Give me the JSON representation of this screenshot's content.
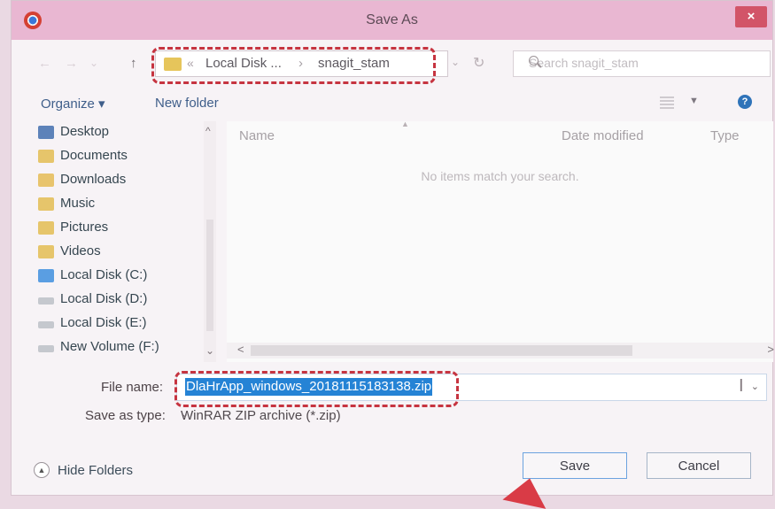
{
  "window": {
    "title": "Save As",
    "close_glyph": "×"
  },
  "toolbar": {
    "back_glyph": "←",
    "forward_glyph": "→",
    "recent_glyph": "⌄",
    "up_glyph": "↑",
    "address": {
      "overflow": "«",
      "part1": "Local Disk ...",
      "separator": "›",
      "part2": "snagit_stam"
    },
    "dropdown_glyph": "⌄",
    "refresh_glyph": "↻",
    "search_placeholder": "Search snagit_stam"
  },
  "commands": {
    "organize": "Organize ▾",
    "new_folder": "New folder",
    "view_chevron": "▼",
    "help": "?"
  },
  "sidebar": {
    "items": [
      {
        "label": "Desktop",
        "icon": "desktop-icon",
        "color": "#5d82b9"
      },
      {
        "label": "Documents",
        "icon": "documents-icon",
        "color": "#e6c56b"
      },
      {
        "label": "Downloads",
        "icon": "downloads-icon",
        "color": "#e8c46d"
      },
      {
        "label": "Music",
        "icon": "music-icon",
        "color": "#e6c56b"
      },
      {
        "label": "Pictures",
        "icon": "pictures-icon",
        "color": "#e6c56b"
      },
      {
        "label": "Videos",
        "icon": "videos-icon",
        "color": "#e6c56b"
      },
      {
        "label": "Local Disk (C:)",
        "icon": "windows-drive-icon",
        "color": "#5a9ee2"
      },
      {
        "label": "Local Disk (D:)",
        "icon": "drive-icon",
        "color": "#c5c8ce"
      },
      {
        "label": "Local Disk (E:)",
        "icon": "drive-icon",
        "color": "#c5c8ce"
      },
      {
        "label": "New Volume (F:)",
        "icon": "drive-icon",
        "color": "#c5c8ce"
      }
    ],
    "scroll_up": "^",
    "scroll_down": "⌄"
  },
  "content": {
    "columns": {
      "name": "Name",
      "date_modified": "Date modified",
      "type": "Type"
    },
    "sort_caret": "▲",
    "empty_message": "No items match your search.",
    "scroll_left": "<",
    "scroll_right": ">"
  },
  "form": {
    "file_name_label": "File name:",
    "file_name_value": "DlaHrApp_windows_20181115183138.zip",
    "save_as_type_label": "Save as type:",
    "save_as_type_value": "WinRAR ZIP archive (*.zip)",
    "text_cursor": "I",
    "dropdown": "⌄"
  },
  "footer": {
    "hide_folders_icon": "▲",
    "hide_folders_label": "Hide Folders",
    "save": "Save",
    "cancel": "Cancel"
  },
  "colors": {
    "annotation_red": "#c63440",
    "arrow_blue": "#2b9ac4",
    "selection_blue": "#2583d5"
  }
}
